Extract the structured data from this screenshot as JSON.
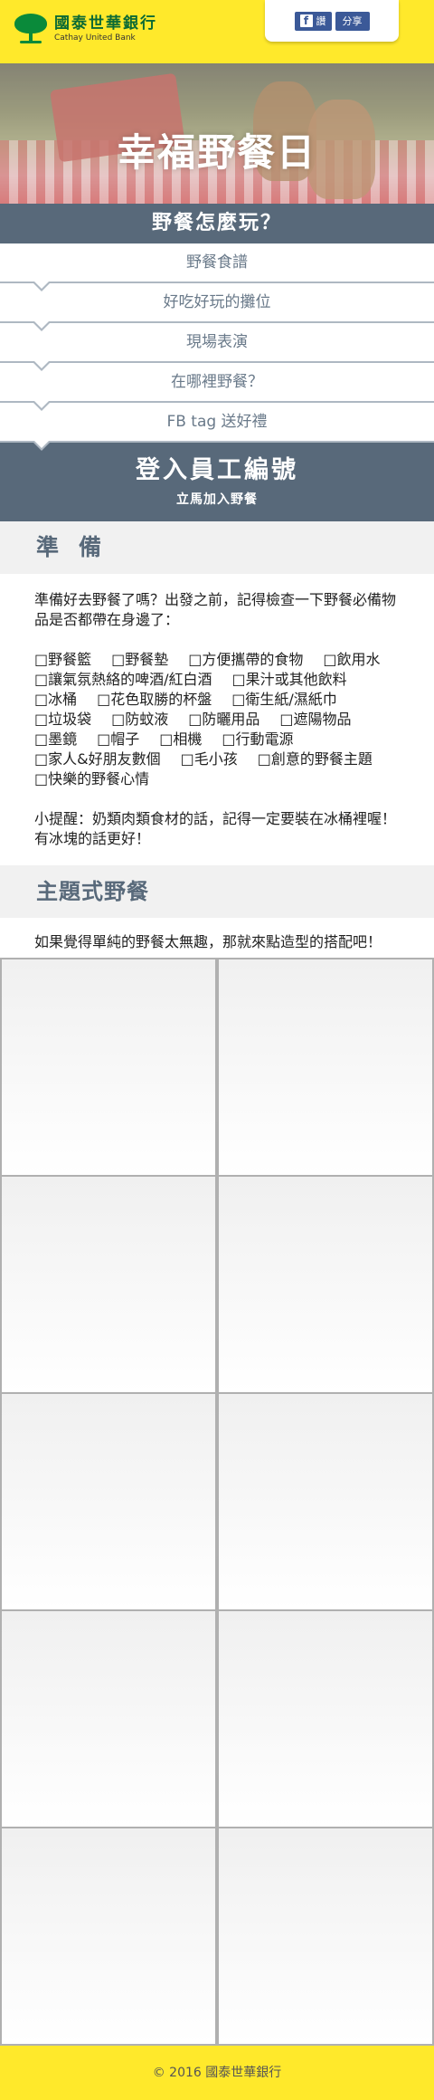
{
  "header": {
    "brand_name": "國泰世華銀行",
    "brand_en": "Cathay United Bank",
    "fb_like_label": "讚",
    "fb_share_label": "分享"
  },
  "hero": {
    "title": "幸福野餐日"
  },
  "menu": {
    "heading": "野餐怎麼玩？",
    "items": [
      {
        "label": "野餐食譜"
      },
      {
        "label": "好吃好玩的攤位"
      },
      {
        "label": "現場表演"
      },
      {
        "label": "在哪裡野餐？"
      },
      {
        "label": "FB tag 送好禮"
      }
    ]
  },
  "login": {
    "title": "登入員工編號",
    "subtitle": "立馬加入野餐"
  },
  "prepare": {
    "title": "準備",
    "intro": "準備好去野餐了嗎？出發之前，記得檢查一下野餐必備物品是否都帶在身邊了：",
    "checklist": [
      "□野餐籃",
      "□野餐墊",
      "□方便攜帶的食物",
      "□飲用水",
      "□讓氣氛熱絡的啤酒/紅白酒",
      "□果汁或其他飲料",
      "□冰桶",
      "□花色取勝的杯盤",
      "□衛生紙/濕紙巾",
      "□垃圾袋",
      "□防蚊液",
      "□防曬用品",
      "□遮陽物品",
      "□墨鏡",
      "□帽子",
      "□相機",
      "□行動電源",
      "□家人&好朋友數個",
      "□毛小孩",
      "□創意的野餐主題",
      "□快樂的野餐心情"
    ],
    "tip": "小提醒：奶類肉類食材的話，記得一定要裝在冰桶裡喔！有冰塊的話更好！"
  },
  "theme": {
    "title": "主題式野餐",
    "intro": "如果覺得單純的野餐太無趣，那就來點造型的搭配吧！"
  },
  "footer": {
    "copyright": "© 2016 國泰世華銀行"
  }
}
